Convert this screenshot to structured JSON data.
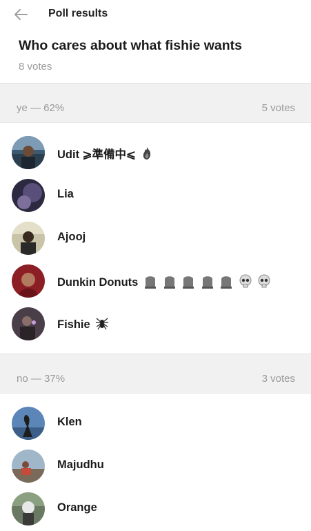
{
  "header": {
    "title": "Poll results",
    "back_icon": "arrow-left-icon"
  },
  "poll": {
    "question": "Who cares about what fishie wants",
    "total_votes": "8 votes"
  },
  "options": [
    {
      "label": "ye — 62%",
      "votes": "5 votes",
      "voters": [
        {
          "name": "Udit ⩾準備中⩽",
          "extra_icons": [
            "fire-icon"
          ]
        },
        {
          "name": "Lia",
          "extra_icons": []
        },
        {
          "name": "Ajooj",
          "extra_icons": []
        },
        {
          "name": "Dunkin Donuts",
          "extra_icons": [
            "headstone-icon",
            "headstone-icon",
            "headstone-icon",
            "headstone-icon",
            "headstone-icon",
            "skull-icon",
            "skull-icon"
          ]
        },
        {
          "name": "Fishie",
          "extra_icons": [
            "spider-icon"
          ]
        }
      ]
    },
    {
      "label": "no — 37%",
      "votes": "3 votes",
      "voters": [
        {
          "name": "Klen",
          "extra_icons": []
        },
        {
          "name": "Majudhu",
          "extra_icons": []
        },
        {
          "name": "Orange",
          "extra_icons": []
        }
      ]
    }
  ],
  "colors": {
    "section_bg": "#f1f1f1",
    "muted_text": "#9a9a9a",
    "primary_text": "#1b1b1b"
  }
}
